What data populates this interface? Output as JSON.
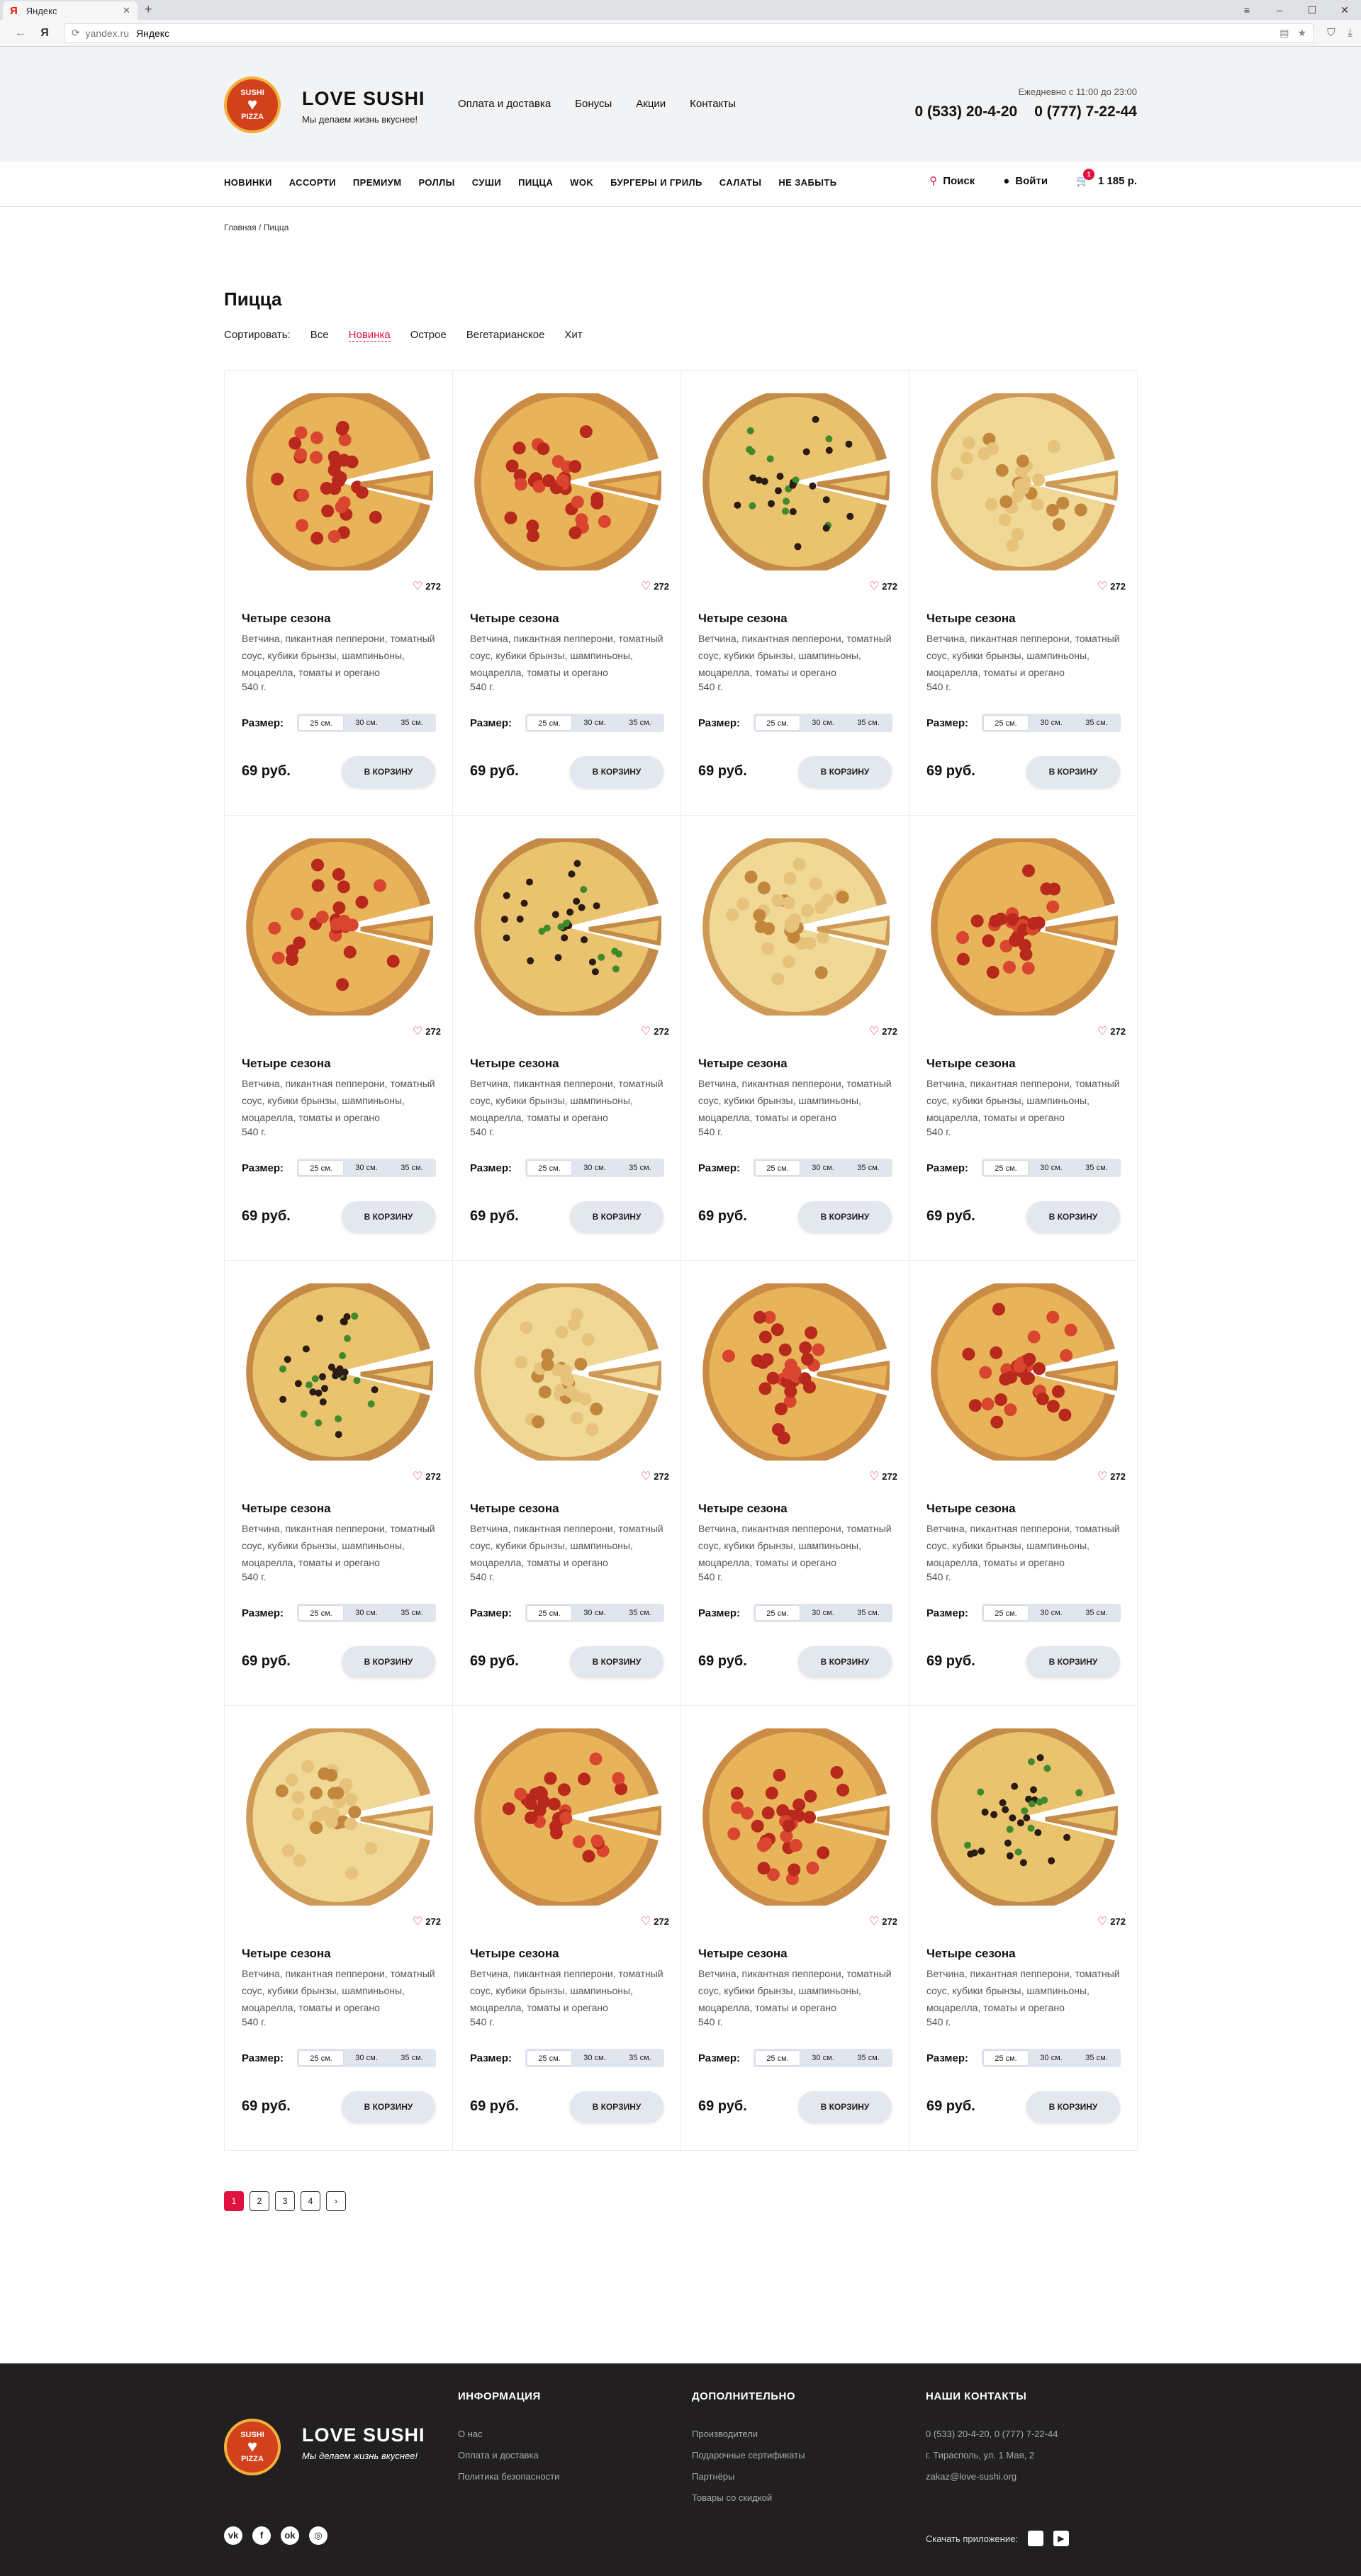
{
  "browser": {
    "tab_title": "Яндекс",
    "url_host": "yandex.ru",
    "url_title": "Яндекс"
  },
  "header": {
    "brand_name": "LOVE SUSHI",
    "tagline": "Мы делаем жизнь вкуснее!",
    "logo_top": "SUSHI",
    "logo_bottom": "PIZZA",
    "nav": [
      "Оплата и доставка",
      "Бонусы",
      "Акции",
      "Контакты"
    ],
    "hours": "Ежедневно с 11:00 до 23:00",
    "phone1": "0 (533) 20-4-20",
    "phone2": "0 (777) 7-22-44"
  },
  "categories": [
    "НОВИНКИ",
    "АССОРТИ",
    "ПРЕМИУМ",
    "РОЛЛЫ",
    "СУШИ",
    "ПИЦЦА",
    "WOK",
    "БУРГЕРЫ И ГРИЛЬ",
    "САЛАТЫ",
    "НЕ ЗАБЫТЬ"
  ],
  "search_label": "Поиск",
  "login_label": "Войти",
  "cart": {
    "count": "1",
    "total": "1 185 р."
  },
  "breadcrumb": {
    "home": "Главная",
    "current": "Пицца"
  },
  "page_title": "Пицца",
  "sort": {
    "label": "Сортировать:",
    "options": [
      "Все",
      "Новинка",
      "Острое",
      "Вегетарианское",
      "Хит"
    ],
    "active": "Новинка"
  },
  "product_template": {
    "title": "Четыре сезона",
    "description": "Ветчина, пикантная пепперони, томатный соус, кубики брынзы, шампиньоны, моцарелла, томаты и орегано",
    "weight": "540 г.",
    "likes": "272",
    "size_label": "Размер:",
    "sizes": [
      "25 см.",
      "30 см.",
      "35 см."
    ],
    "price": "69 руб.",
    "button": "В КОРЗИНУ"
  },
  "pizza_styles": [
    "pepperoni",
    "pepperoni",
    "olive",
    "cheese",
    "pepperoni",
    "olive",
    "cheese",
    "pepperoni",
    "olive",
    "cheese",
    "pepperoni",
    "pepperoni",
    "cheese",
    "pepperoni",
    "pepperoni",
    "olive"
  ],
  "pagination": [
    "1",
    "2",
    "3",
    "4",
    "›"
  ],
  "footer": {
    "brand_name": "LOVE SUSHI",
    "tagline": "Мы делаем жизнь вкуснее!",
    "info_title": "ИНФОРМАЦИЯ",
    "info_links": [
      "О нас",
      "Оплата и доставка",
      "Политика безопасности"
    ],
    "extra_title": "ДОПОЛНИТЕЛЬНО",
    "extra_links": [
      "Производители",
      "Подарочные сертификаты",
      "Партнёры",
      "Товары со скидкой"
    ],
    "contacts_title": "НАШИ КОНТАКТЫ",
    "contacts": [
      "0 (533) 20-4-20, 0 (777) 7-22-44",
      "г. Тирасполь, ул. 1 Мая, 2",
      "zakaz@love-sushi.org"
    ],
    "social": [
      "vk",
      "f",
      "ok",
      "◎"
    ],
    "app_label": "Скачать приложение:"
  }
}
